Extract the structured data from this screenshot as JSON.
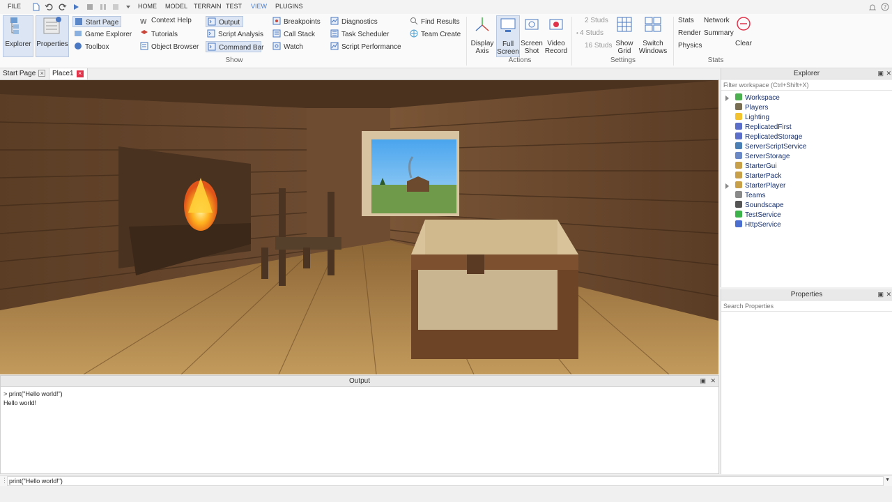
{
  "menu": {
    "file": "FILE",
    "tabs": [
      "HOME",
      "MODEL",
      "TERRAIN",
      "TEST",
      "VIEW",
      "PLUGINS"
    ],
    "active_tab": "VIEW"
  },
  "ribbon": {
    "big": {
      "explorer": "Explorer",
      "properties": "Properties",
      "display_axis": [
        "Display",
        "Axis"
      ],
      "full_screen": [
        "Full",
        "Screen"
      ],
      "screen_shot": [
        "Screen",
        "Shot"
      ],
      "video_record": [
        "Video",
        "Record"
      ],
      "show_grid": [
        "Show",
        "Grid"
      ],
      "switch_windows": [
        "Switch",
        "Windows"
      ],
      "clear": "Clear"
    },
    "col1": [
      "Start Page",
      "Game Explorer",
      "Toolbox"
    ],
    "col2": [
      "Context Help",
      "Tutorials",
      "Object Browser"
    ],
    "col3": [
      "Output",
      "Script Analysis",
      "Command Bar"
    ],
    "col4": [
      "Breakpoints",
      "Call Stack",
      "Watch"
    ],
    "col5": [
      "Diagnostics",
      "Task Scheduler",
      "Script Performance"
    ],
    "col6": [
      "Find Results",
      "Team Create"
    ],
    "studs": [
      "2 Studs",
      "4 Studs",
      "16 Studs"
    ],
    "stats_col1": [
      "Stats",
      "Render",
      "Physics"
    ],
    "stats_col2": [
      "Network",
      "Summary"
    ],
    "groups": {
      "show": "Show",
      "actions": "Actions",
      "settings": "Settings",
      "stats": "Stats"
    }
  },
  "doc_tabs": [
    "Start Page",
    "Place1"
  ],
  "output": {
    "title": "Output",
    "lines": [
      "> print(\"Hello world!\")",
      "Hello world!"
    ]
  },
  "command_bar": {
    "value": "print(\"Hello world!\")"
  },
  "explorer": {
    "title": "Explorer",
    "filter_placeholder": "Filter workspace (Ctrl+Shift+X)",
    "items": [
      {
        "label": "Workspace",
        "icon": "globe-icon",
        "color": "#4caf50",
        "expandable": true
      },
      {
        "label": "Players",
        "icon": "players-icon",
        "color": "#7a6e52",
        "expandable": false
      },
      {
        "label": "Lighting",
        "icon": "lightbulb-icon",
        "color": "#f2c230",
        "expandable": false
      },
      {
        "label": "ReplicatedFirst",
        "icon": "replicated-first-icon",
        "color": "#5b6ec9",
        "expandable": false
      },
      {
        "label": "ReplicatedStorage",
        "icon": "replicated-storage-icon",
        "color": "#5b6ec9",
        "expandable": false
      },
      {
        "label": "ServerScriptService",
        "icon": "server-script-icon",
        "color": "#4a7fb5",
        "expandable": false
      },
      {
        "label": "ServerStorage",
        "icon": "server-storage-icon",
        "color": "#6a88c6",
        "expandable": false
      },
      {
        "label": "StarterGui",
        "icon": "starter-gui-icon",
        "color": "#c9a04a",
        "expandable": false
      },
      {
        "label": "StarterPack",
        "icon": "starter-pack-icon",
        "color": "#c9a04a",
        "expandable": false
      },
      {
        "label": "StarterPlayer",
        "icon": "starter-player-icon",
        "color": "#c9a04a",
        "expandable": true
      },
      {
        "label": "Teams",
        "icon": "teams-icon",
        "color": "#8a8a8a",
        "expandable": false
      },
      {
        "label": "Soundscape",
        "icon": "speaker-icon",
        "color": "#555",
        "expandable": false
      },
      {
        "label": "TestService",
        "icon": "check-icon",
        "color": "#3cb44b",
        "expandable": false
      },
      {
        "label": "HttpService",
        "icon": "http-icon",
        "color": "#4a6fd1",
        "expandable": false
      }
    ]
  },
  "properties": {
    "title": "Properties",
    "search_placeholder": "Search Properties"
  }
}
